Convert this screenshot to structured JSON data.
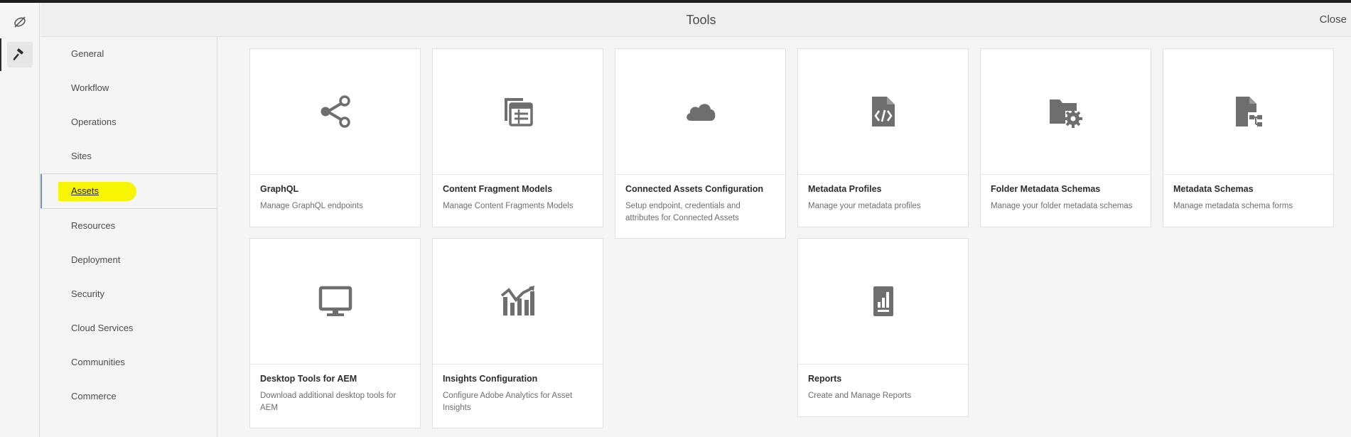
{
  "header": {
    "title": "Tools",
    "close_label": "Close"
  },
  "rail": {
    "logo_icon": "adobe-experience-icon",
    "tools_icon": "hammer-icon"
  },
  "sidebar": {
    "items": [
      {
        "label": "General"
      },
      {
        "label": "Workflow"
      },
      {
        "label": "Operations"
      },
      {
        "label": "Sites"
      },
      {
        "label": "Assets",
        "active": true,
        "highlighted": true
      },
      {
        "label": "Resources"
      },
      {
        "label": "Deployment"
      },
      {
        "label": "Security"
      },
      {
        "label": "Cloud Services"
      },
      {
        "label": "Communities"
      },
      {
        "label": "Commerce"
      }
    ]
  },
  "tools": [
    {
      "title": "GraphQL",
      "description": "Manage GraphQL endpoints",
      "icon": "share-icon"
    },
    {
      "title": "Content Fragment Models",
      "description": "Manage Content Fragments Models",
      "icon": "content-fragment-icon"
    },
    {
      "title": "Connected Assets Configuration",
      "description": "Setup endpoint, credentials and attributes for Connected Assets",
      "icon": "cloud-icon"
    },
    {
      "title": "Metadata Profiles",
      "description": "Manage your metadata profiles",
      "icon": "file-code-icon"
    },
    {
      "title": "Folder Metadata Schemas",
      "description": "Manage your folder metadata schemas",
      "icon": "folder-gear-icon"
    },
    {
      "title": "Metadata Schemas",
      "description": "Manage metadata schema forms",
      "icon": "file-schema-icon"
    },
    {
      "title": "Desktop Tools for AEM",
      "description": "Download additional desktop tools for AEM",
      "icon": "monitor-icon"
    },
    {
      "title": "Insights Configuration",
      "description": "Configure Adobe Analytics for Asset Insights",
      "icon": "insights-chart-icon"
    },
    {
      "title": "Reports",
      "description": "Create and Manage Reports",
      "icon": "report-icon"
    }
  ],
  "colors": {
    "accent": "#6e8fbf",
    "highlight": "#f7f600",
    "icon": "#6e6e6e"
  }
}
